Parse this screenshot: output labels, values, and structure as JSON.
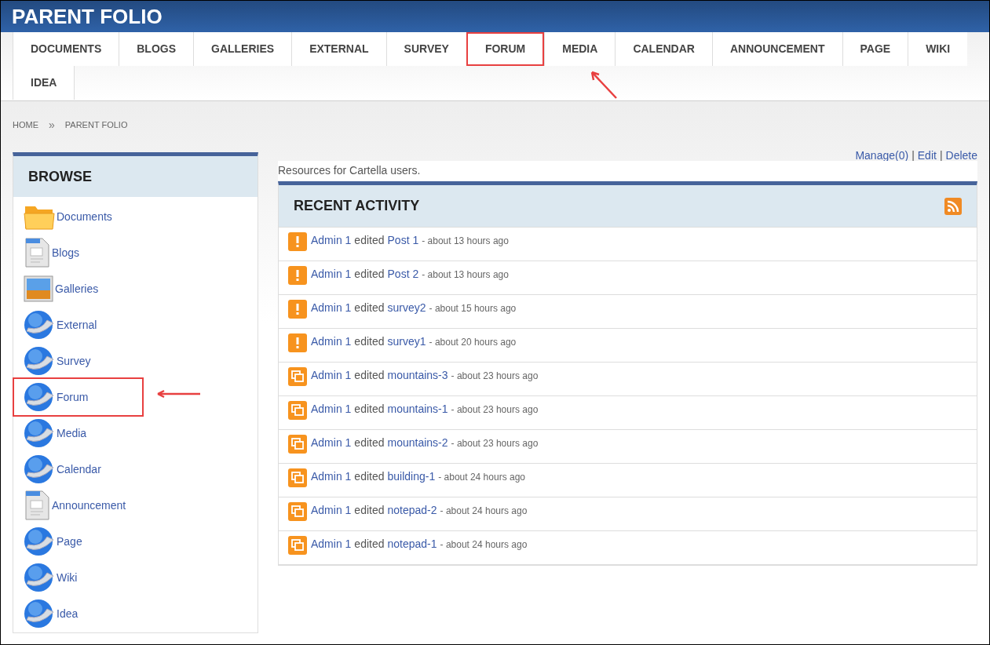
{
  "header": {
    "title": "PARENT FOLIO"
  },
  "tabs": [
    {
      "label": "DOCUMENTS",
      "highlighted": false
    },
    {
      "label": "BLOGS",
      "highlighted": false
    },
    {
      "label": "GALLERIES",
      "highlighted": false
    },
    {
      "label": "EXTERNAL",
      "highlighted": false
    },
    {
      "label": "SURVEY",
      "highlighted": false
    },
    {
      "label": "FORUM",
      "highlighted": true
    },
    {
      "label": "MEDIA",
      "highlighted": false
    },
    {
      "label": "CALENDAR",
      "highlighted": false
    },
    {
      "label": "ANNOUNCEMENT",
      "highlighted": false
    },
    {
      "label": "PAGE",
      "highlighted": false
    },
    {
      "label": "WIKI",
      "highlighted": false
    },
    {
      "label": "IDEA",
      "highlighted": false
    }
  ],
  "breadcrumb": {
    "items": [
      "HOME",
      "PARENT FOLIO"
    ],
    "separator": "»"
  },
  "actions": [
    "Manage(0)",
    "Edit",
    "Delete"
  ],
  "action_separator": "|",
  "description": "Resources for Cartella users.",
  "sidebar": {
    "title": "BROWSE",
    "items": [
      {
        "label": "Documents",
        "kind": "folder",
        "highlighted": false
      },
      {
        "label": "Blogs",
        "kind": "document",
        "highlighted": false
      },
      {
        "label": "Galleries",
        "kind": "gallery",
        "highlighted": false
      },
      {
        "label": "External",
        "kind": "globe",
        "highlighted": false
      },
      {
        "label": "Survey",
        "kind": "globe",
        "highlighted": false
      },
      {
        "label": "Forum",
        "kind": "globe",
        "highlighted": true
      },
      {
        "label": "Media",
        "kind": "globe",
        "highlighted": false
      },
      {
        "label": "Calendar",
        "kind": "globe",
        "highlighted": false
      },
      {
        "label": "Announcement",
        "kind": "document",
        "highlighted": false
      },
      {
        "label": "Page",
        "kind": "globe",
        "highlighted": false
      },
      {
        "label": "Wiki",
        "kind": "globe",
        "highlighted": false
      },
      {
        "label": "Idea",
        "kind": "globe",
        "highlighted": false
      }
    ]
  },
  "activity": {
    "title": "RECENT ACTIVITY",
    "items": [
      {
        "kind": "alert",
        "user": "Admin 1",
        "verb": "edited",
        "target": "Post 1",
        "time": "- about 13 hours ago"
      },
      {
        "kind": "alert",
        "user": "Admin 1",
        "verb": "edited",
        "target": "Post 2",
        "time": "- about 13 hours ago"
      },
      {
        "kind": "alert",
        "user": "Admin 1",
        "verb": "edited",
        "target": "survey2",
        "time": "- about 15 hours ago"
      },
      {
        "kind": "alert",
        "user": "Admin 1",
        "verb": "edited",
        "target": "survey1",
        "time": "- about 20 hours ago"
      },
      {
        "kind": "image",
        "user": "Admin 1",
        "verb": "edited",
        "target": "mountains-3",
        "time": "- about 23 hours ago"
      },
      {
        "kind": "image",
        "user": "Admin 1",
        "verb": "edited",
        "target": "mountains-1",
        "time": "- about 23 hours ago"
      },
      {
        "kind": "image",
        "user": "Admin 1",
        "verb": "edited",
        "target": "mountains-2",
        "time": "- about 23 hours ago"
      },
      {
        "kind": "image",
        "user": "Admin 1",
        "verb": "edited",
        "target": "building-1",
        "time": "- about 24 hours ago"
      },
      {
        "kind": "image",
        "user": "Admin 1",
        "verb": "edited",
        "target": "notepad-2",
        "time": "- about 24 hours ago"
      },
      {
        "kind": "image",
        "user": "Admin 1",
        "verb": "edited",
        "target": "notepad-1",
        "time": "- about 24 hours ago"
      }
    ]
  }
}
